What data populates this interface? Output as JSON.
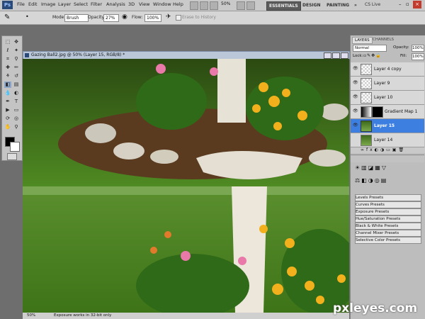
{
  "app": {
    "logo": "Ps"
  },
  "menu": [
    "File",
    "Edit",
    "Image",
    "Layer",
    "Select",
    "Filter",
    "Analysis",
    "3D",
    "View",
    "Window",
    "Help"
  ],
  "topbar": {
    "zoom": "50%",
    "workspaces": [
      "ESSENTIALS",
      "DESIGN",
      "PAINTING"
    ],
    "more": "»",
    "cslive": "CS Live"
  },
  "options": {
    "mode_label": "Mode:",
    "mode_value": "Brush",
    "opacity_label": "Opacity:",
    "opacity_value": "27%",
    "flow_label": "Flow:",
    "flow_value": "100%",
    "erase_history": "Erase to History"
  },
  "document": {
    "title": "Gazing Ball2.jpg @ 50% (Layer 15, RGB/8) *",
    "status_zoom": "50%",
    "status_text": "Exposure works in 32-bit only"
  },
  "layers_panel": {
    "tabs": [
      "LAYERS",
      "CHANNELS"
    ],
    "blend_mode": "Normal",
    "opacity_label": "Opacity:",
    "opacity_value": "100%",
    "lock_label": "Lock:",
    "fill_label": "Fill:",
    "fill_value": "100%",
    "layers": [
      {
        "name": "Layer 4 copy",
        "selected": false
      },
      {
        "name": "Layer 9",
        "selected": false
      },
      {
        "name": "Layer 10",
        "selected": false
      },
      {
        "name": "Gradient Map 1",
        "selected": false
      },
      {
        "name": "Layer 15",
        "selected": true
      },
      {
        "name": "Layer 14",
        "selected": false
      }
    ]
  },
  "adjustments": {
    "presets": [
      "Levels Presets",
      "Curves Presets",
      "Exposure Presets",
      "Hue/Saturation Presets",
      "Black & White Presets",
      "Channel Mixer Presets",
      "Selective Color Presets"
    ]
  },
  "watermark": "pxleyes.com"
}
